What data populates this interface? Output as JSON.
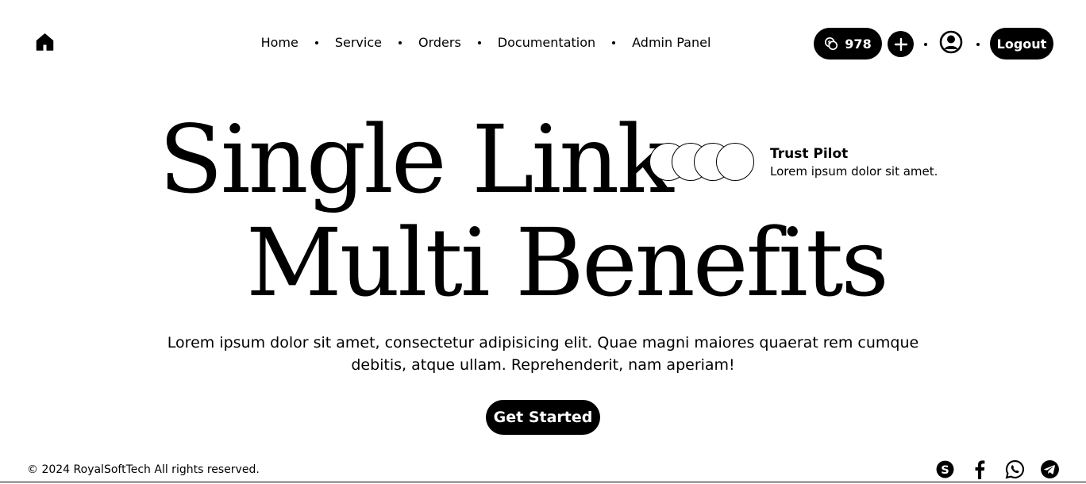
{
  "nav": {
    "links": [
      "Home",
      "Service",
      "Orders",
      "Documentation",
      "Admin Panel"
    ],
    "credits": "978",
    "logout": "Logout"
  },
  "hero": {
    "line1": "Single Link",
    "line2": "Multi Benefits",
    "trust_title": "Trust Pilot",
    "trust_sub": "Lorem ipsum dolor sit amet.",
    "description": "Lorem ipsum dolor sit amet, consectetur adipisicing elit. Quae magni maiores quaerat rem cumque debitis, atque ullam. Reprehenderit, nam aperiam!",
    "cta": "Get Started"
  },
  "footer": {
    "copyright": "© 2024 RoyalSoftTech All rights reserved."
  },
  "icons": [
    "home-icon",
    "coins-icon",
    "plus-icon",
    "user-icon",
    "skype-icon",
    "facebook-icon",
    "whatsapp-icon",
    "telegram-icon"
  ],
  "colors": {
    "primary": "#000000",
    "background": "#ffffff",
    "on_primary": "#ffffff"
  }
}
